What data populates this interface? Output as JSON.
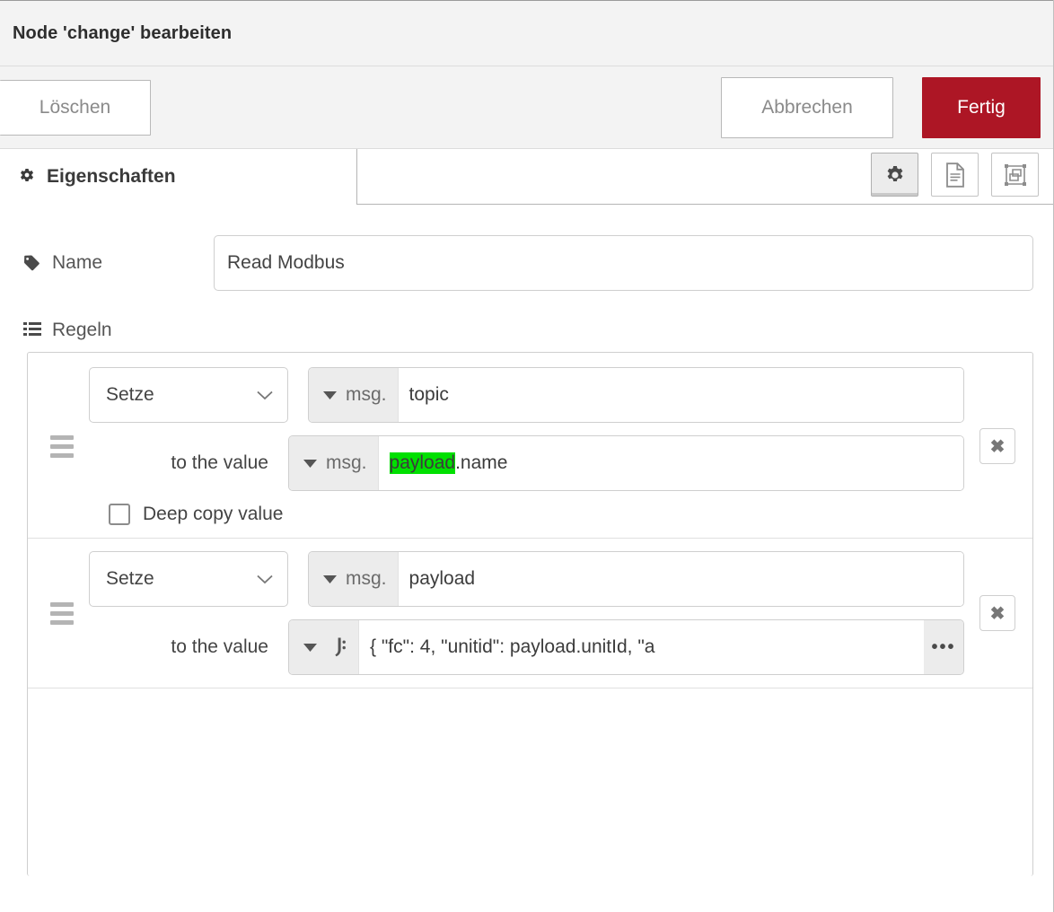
{
  "window": {
    "title": "Node 'change' bearbeiten"
  },
  "toolbar": {
    "delete_label": "Löschen",
    "cancel_label": "Abbrechen",
    "done_label": "Fertig",
    "done_color": "#ad1625"
  },
  "tabs": [
    {
      "label": "Eigenschaften",
      "icon": "gear-icon",
      "active": true
    }
  ],
  "tab_icons": [
    {
      "name": "gear-icon",
      "active": true
    },
    {
      "name": "description-icon",
      "active": false
    },
    {
      "name": "appearance-icon",
      "active": false
    }
  ],
  "form": {
    "name_label": "Name",
    "name_icon": "tag-icon",
    "name_value": "Read Modbus",
    "name_placeholder": "Name",
    "rules_label": "Regeln",
    "rules_icon": "list-icon"
  },
  "rules": [
    {
      "action": "Setze",
      "target_type": "msg.",
      "target_value": "topic",
      "value_label": "to the value",
      "value_type": "msg.",
      "value_prefix": "",
      "value_highlight": "payload",
      "value_suffix": ".name",
      "deep_copy_label": "Deep copy value",
      "deep_copy_checked": false,
      "delete_label": "✖"
    },
    {
      "action": "Setze",
      "target_type": "msg.",
      "target_value": "payload",
      "value_label": "to the value",
      "value_type": "json",
      "value_text": "{      \"fc\": 4,    \"unitid\": payload.unitId,        \"a",
      "expand_label": "•••",
      "delete_label": "✖"
    }
  ],
  "colors": {
    "accent_red": "#ad1625",
    "highlight_green": "#00e000",
    "panel_gray": "#f3f3f3",
    "field_gray": "#ececec"
  }
}
